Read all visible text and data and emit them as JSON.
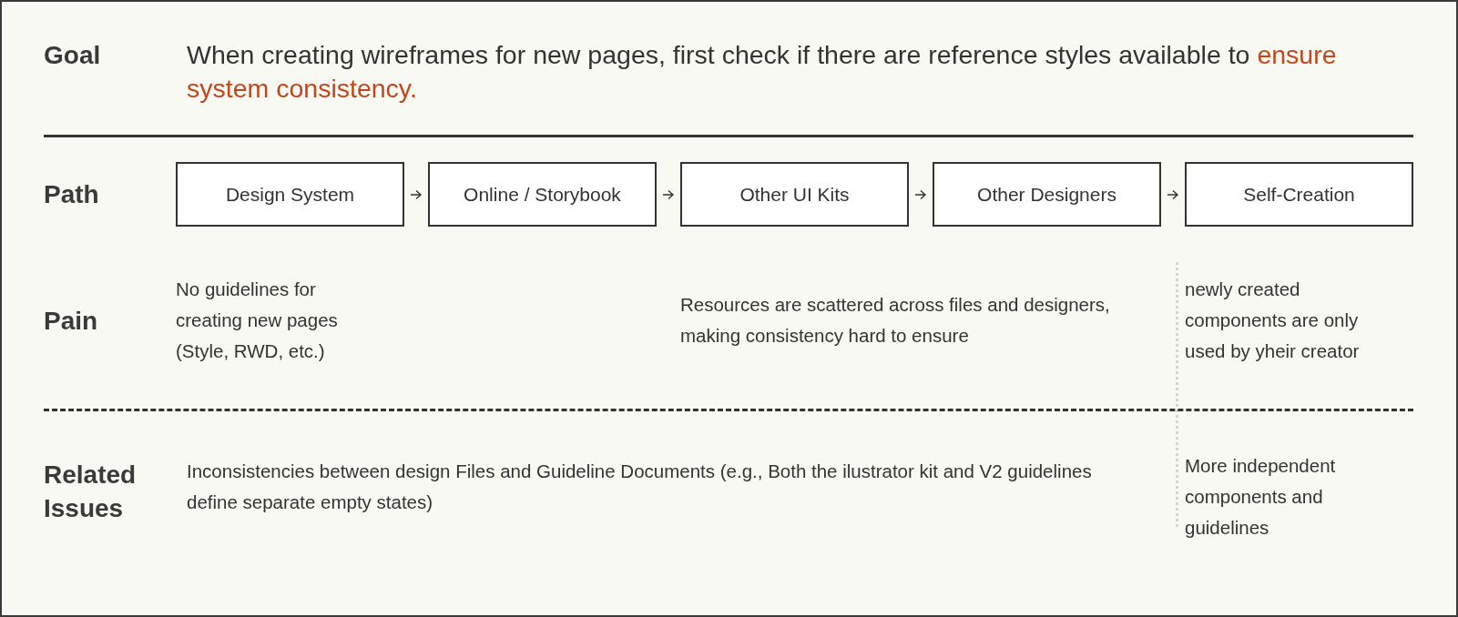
{
  "goal": {
    "label": "Goal",
    "text": "When creating wireframes for new pages, first check if there are reference styles available to ",
    "highlight": "ensure system consistency."
  },
  "path": {
    "label": "Path",
    "steps": [
      "Design System",
      "Online / Storybook",
      "Other UI Kits",
      "Other Designers",
      "Self-Creation"
    ]
  },
  "pain": {
    "label": "Pain",
    "items": [
      "No guidelines for creating new pages (Style, RWD, etc.)",
      "Resources are scattered across files and designers, making consistency hard to ensure",
      "newly created components are only used by yheir creator"
    ]
  },
  "related": {
    "label": "Related Issues",
    "items": [
      "Inconsistencies between design Files and Guideline Documents (e.g., Both the ilustrator kit and V2 guidelines define separate empty states)",
      "More independent components and guidelines"
    ]
  }
}
